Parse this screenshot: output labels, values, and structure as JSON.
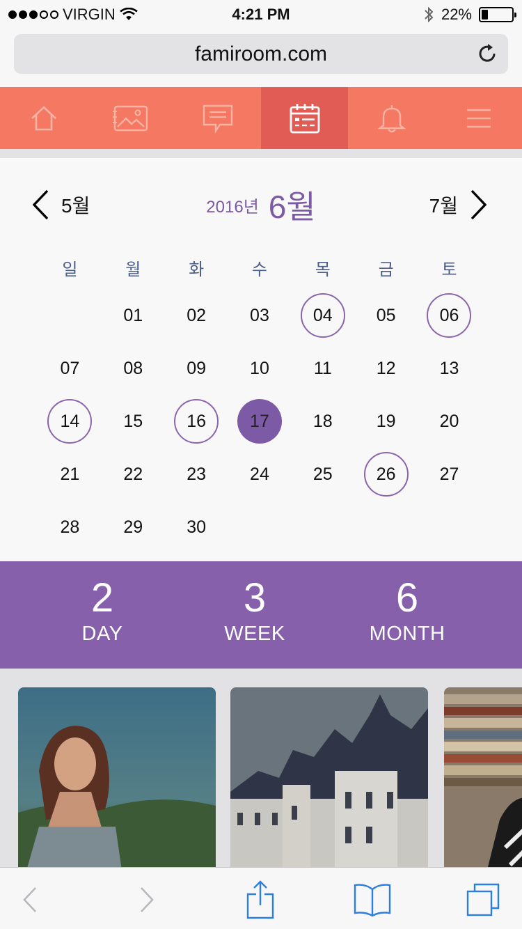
{
  "status": {
    "carrier": "VIRGIN",
    "signal_filled": 3,
    "signal_total": 5,
    "time": "4:21 PM",
    "battery": "22%",
    "battery_level": 0.22
  },
  "browser": {
    "url": "famiroom.com"
  },
  "nav": {
    "items": [
      {
        "icon": "home-icon"
      },
      {
        "icon": "photo-album-icon"
      },
      {
        "icon": "chat-icon"
      },
      {
        "icon": "calendar-icon",
        "active": true
      },
      {
        "icon": "bell-icon"
      },
      {
        "icon": "menu-icon"
      }
    ],
    "colors": {
      "bar": "#f47862",
      "active": "#e05c54"
    }
  },
  "calendar": {
    "prev_month": "5월",
    "next_month": "7월",
    "year": "2016년",
    "month": "6월",
    "weekdays": [
      "일",
      "월",
      "화",
      "수",
      "목",
      "금",
      "토"
    ],
    "first_weekday_index": 1,
    "days": [
      "01",
      "02",
      "03",
      "04",
      "05",
      "06",
      "07",
      "08",
      "09",
      "10",
      "11",
      "12",
      "13",
      "14",
      "15",
      "16",
      "17",
      "18",
      "19",
      "20",
      "21",
      "22",
      "23",
      "24",
      "25",
      "26",
      "27",
      "28",
      "29",
      "30"
    ],
    "marked": [
      "04",
      "06",
      "14",
      "16",
      "26"
    ],
    "today": "17",
    "accent": "#8660aa"
  },
  "stats": [
    {
      "value": "2",
      "label": "DAY"
    },
    {
      "value": "3",
      "label": "WEEK"
    },
    {
      "value": "6",
      "label": "MONTH"
    }
  ],
  "toolbar": {
    "items": [
      {
        "icon": "back-icon",
        "enabled": false
      },
      {
        "icon": "forward-icon",
        "enabled": false
      },
      {
        "icon": "share-icon",
        "enabled": true
      },
      {
        "icon": "bookmarks-icon",
        "enabled": true
      },
      {
        "icon": "tabs-icon",
        "enabled": true
      }
    ]
  }
}
